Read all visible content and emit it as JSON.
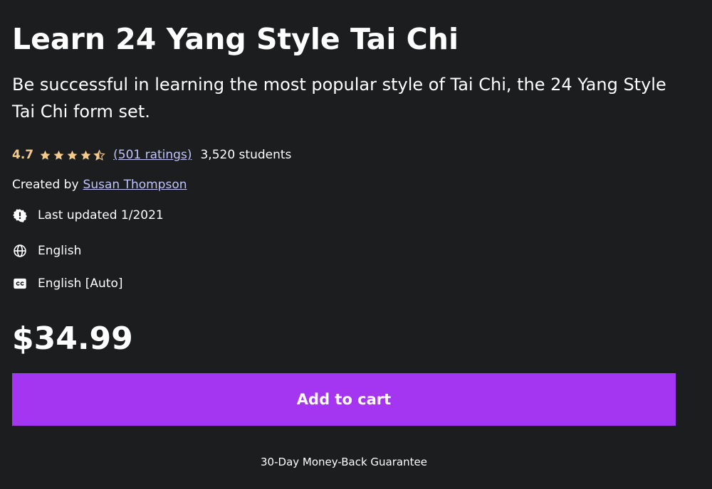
{
  "course": {
    "title": "Learn 24 Yang Style Tai Chi",
    "subtitle": "Be successful in learning the most popular style of Tai Chi, the 24 Yang Style Tai Chi form set."
  },
  "rating": {
    "value": "4.7",
    "stars": 4.7,
    "ratings_link": "(501 ratings)",
    "students": "3,520 students",
    "star_color": "#f3ca8c"
  },
  "creator": {
    "label": "Created by",
    "name": "Susan Thompson"
  },
  "meta": {
    "last_updated": "Last updated 1/2021",
    "last_updated_icon": "alert-badge-icon",
    "language": "English",
    "language_icon": "globe-icon",
    "captions": "English [Auto]",
    "captions_icon": "closed-captions-icon"
  },
  "purchase": {
    "price": "$34.99",
    "add_to_cart_label": "Add to cart",
    "button_color": "#a435f0",
    "guarantee": "30-Day Money-Back Guarantee"
  },
  "colors": {
    "background": "#1c1d1f",
    "link": "#c0c4fc"
  }
}
